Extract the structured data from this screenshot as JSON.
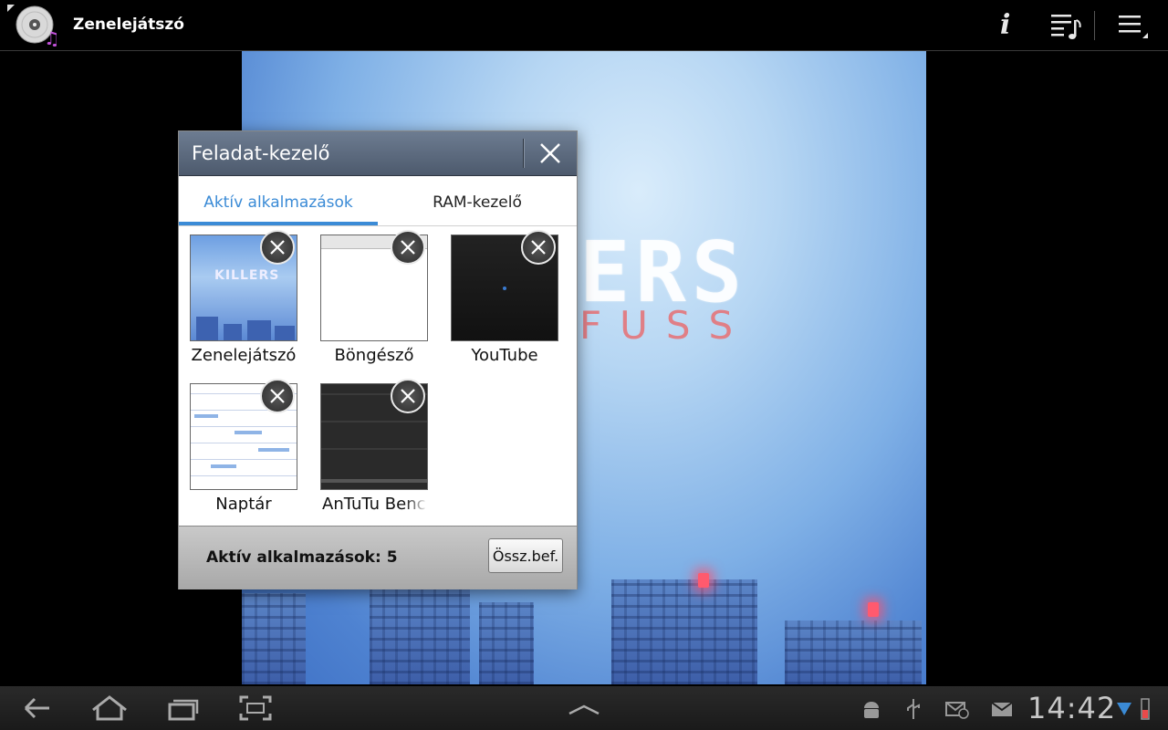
{
  "app": {
    "title": "Zenelejátszó"
  },
  "actionbar": {
    "icons": [
      "info-icon",
      "playlist-icon",
      "overflow-menu-icon"
    ],
    "info_glyph": "i"
  },
  "album_art": {
    "band_text": "ERS",
    "album_text": "FUSS"
  },
  "dialog": {
    "title": "Feladat-kezelő",
    "tabs": [
      {
        "label": "Aktív alkalmazások",
        "active": true
      },
      {
        "label": "RAM-kezelő",
        "active": false
      }
    ],
    "apps": [
      {
        "label": "Zenelejátszó"
      },
      {
        "label": "Böngésző"
      },
      {
        "label": "YouTube"
      },
      {
        "label": "Naptár"
      },
      {
        "label": "AnTuTu Benc"
      }
    ],
    "thumb_text": "KILLERS",
    "footer_count": "Aktív alkalmazások: 5",
    "end_all_label": "Össz.bef."
  },
  "statusbar": {
    "time": "14:42",
    "icons": [
      "back-icon",
      "home-icon",
      "recent-apps-icon",
      "screenshot-icon",
      "up-chevron-icon",
      "android-debug-icon",
      "usb-icon",
      "email-icon",
      "gmail-icon",
      "wifi-icon",
      "battery-icon"
    ]
  },
  "colors": {
    "accent": "#3b8bd6",
    "dialog_header": "#5a687b",
    "battery": "#e84a4a"
  }
}
